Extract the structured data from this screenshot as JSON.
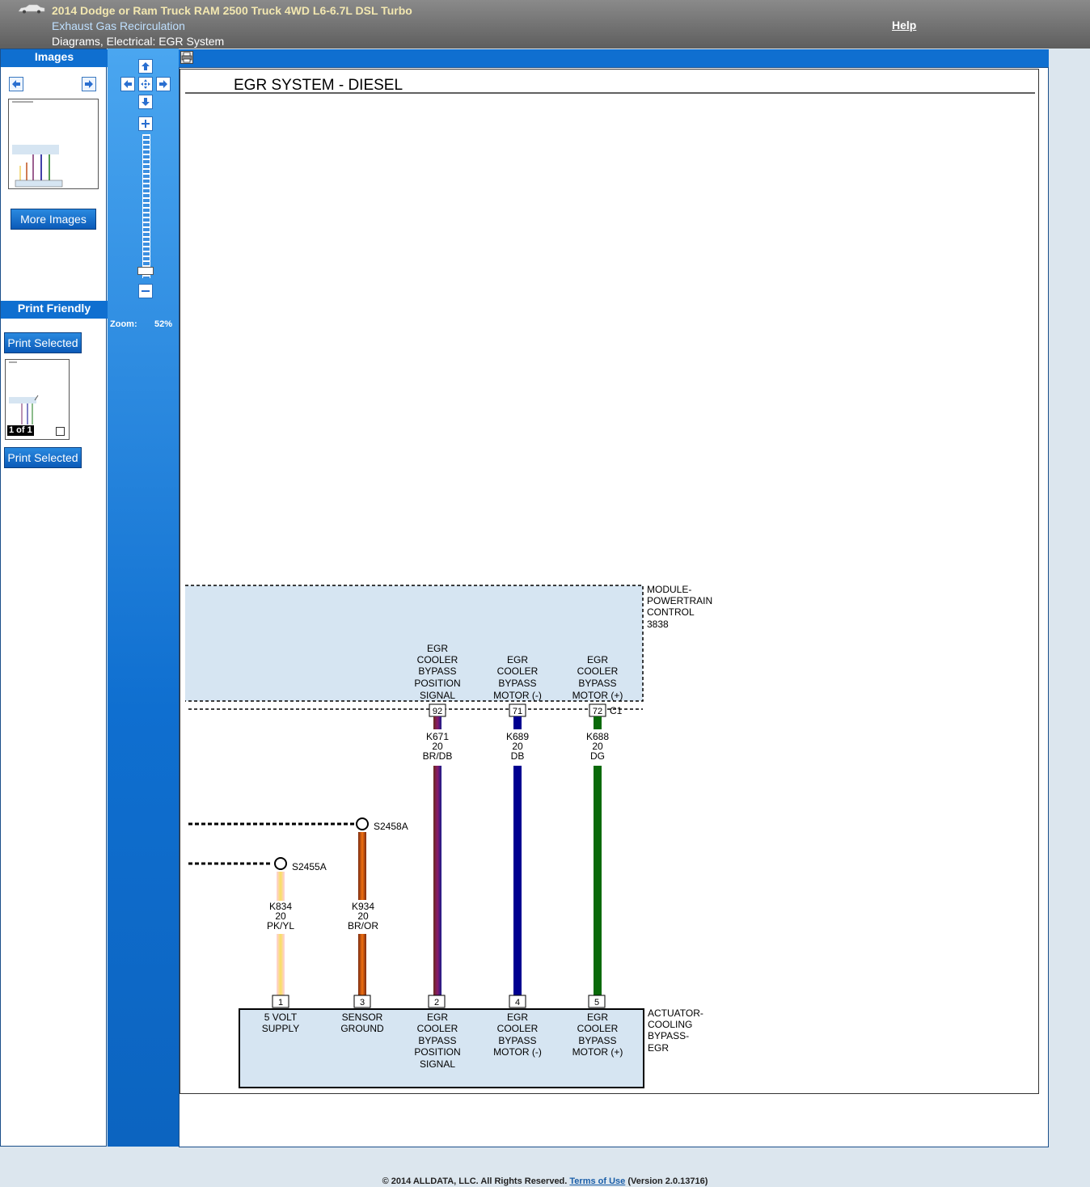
{
  "header": {
    "vehicle_title": "2014 Dodge or Ram Truck RAM 2500 Truck 4WD L6-6.7L DSL Turbo",
    "section": "Exhaust Gas Recirculation",
    "breadcrumb": "Diagrams, Electrical: EGR System",
    "help": "Help"
  },
  "images_panel": {
    "title": "Images",
    "more_images": "More Images"
  },
  "print_panel": {
    "title": "Print Friendly",
    "print_selected": "Print Selected",
    "page_label": "1 of 1"
  },
  "zoom": {
    "label": "Zoom:",
    "value": "52%"
  },
  "diagram": {
    "title": "EGR SYSTEM - DIESEL",
    "pcm": {
      "l1": "MODULE-",
      "l2": "POWERTRAIN",
      "l3": "CONTROL",
      "l4": "3838"
    },
    "connector": "C1",
    "actuator": {
      "l1": "ACTUATOR-",
      "l2": "COOLING",
      "l3": "BYPASS-",
      "l4": "EGR"
    },
    "splices": {
      "s2458a": "S2458A",
      "s2455a": "S2455A"
    },
    "pcm_labels": {
      "pin92": [
        "EGR",
        "COOLER",
        "BYPASS",
        "POSITION",
        "SIGNAL"
      ],
      "pin71": [
        "EGR",
        "COOLER",
        "BYPASS",
        "MOTOR (-)"
      ],
      "pin72": [
        "EGR",
        "COOLER",
        "BYPASS",
        "MOTOR (+)"
      ]
    },
    "pcm_pins": {
      "p92": "92",
      "p71": "71",
      "p72": "72"
    },
    "wires": {
      "k671": [
        "K671",
        "20",
        "BR/DB"
      ],
      "k689": [
        "K689",
        "20",
        "DB"
      ],
      "k688": [
        "K688",
        "20",
        "DG"
      ],
      "k834": [
        "K834",
        "20",
        "PK/YL"
      ],
      "k934": [
        "K934",
        "20",
        "BR/OR"
      ]
    },
    "actuator_pins": {
      "p1": "1",
      "p3": "3",
      "p2": "2",
      "p4": "4",
      "p5": "5"
    },
    "actuator_labels": {
      "pin1": [
        "5 VOLT",
        "SUPPLY"
      ],
      "pin3": [
        "SENSOR",
        "GROUND"
      ],
      "pin2": [
        "EGR",
        "COOLER",
        "BYPASS",
        "POSITION",
        "SIGNAL"
      ],
      "pin4": [
        "EGR",
        "COOLER",
        "BYPASS",
        "MOTOR (-)"
      ],
      "pin5": [
        "EGR",
        "COOLER",
        "BYPASS",
        "MOTOR (+)"
      ]
    }
  },
  "footer": {
    "copyright": "© 2014 ALLDATA, LLC. All Rights Reserved.",
    "terms": "Terms of Use",
    "version": "(Version 2.0.13716)"
  },
  "colors": {
    "header": "#6e6e6e",
    "accent_blue": "#0f6fd0",
    "module_fill": "#d6e5f2"
  }
}
